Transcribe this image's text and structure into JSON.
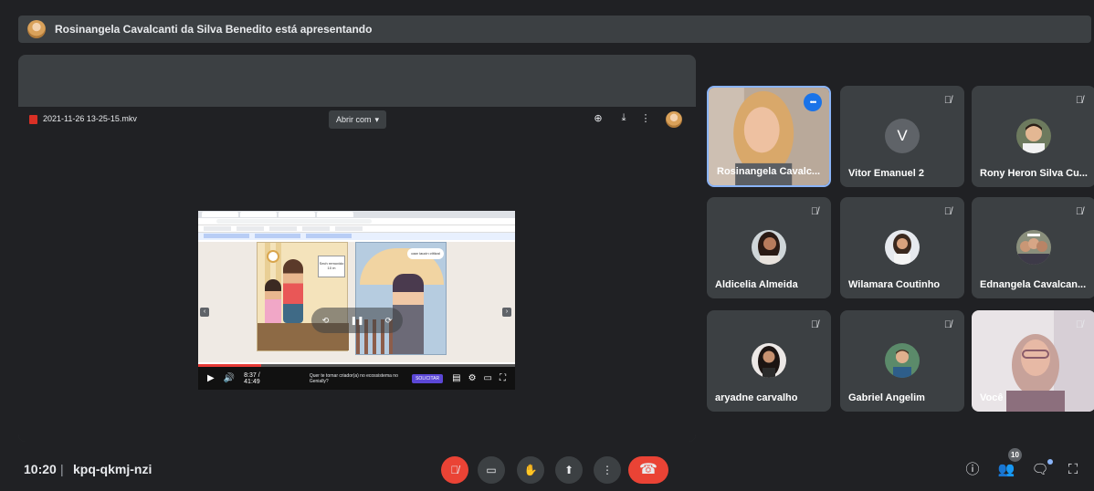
{
  "presentation_bar": {
    "text": "Rosinangela Cavalcanti da Silva Benedito está apresentando"
  },
  "viewer": {
    "file_name": "2021-11-26 13-25-15.mkv",
    "open_with": "Abrir com",
    "icons": [
      "drive-add-icon",
      "download-icon",
      "more-vert-icon"
    ]
  },
  "shared_video": {
    "bubble_left": "Sech removido 10 m",
    "bubble_right": "caar iaucin ctitizal",
    "logo": "genially",
    "time": "8:37 / 41:49",
    "cta": "Quer te tornar criador(a) no ecossistema no Genially?",
    "cta_button": "SOLICITAR",
    "progress_fraction": 0.2
  },
  "participants": [
    {
      "name": "Rosinangela Cavalc...",
      "kind": "video",
      "speaking": true
    },
    {
      "name": "Vitor Emanuel 2",
      "kind": "letter",
      "letter": "V",
      "muted": true
    },
    {
      "name": "Rony Heron Silva Cu...",
      "kind": "photo",
      "muted": true
    },
    {
      "name": "Aldicelia Almeida",
      "kind": "photo",
      "muted": true
    },
    {
      "name": "Wilamara Coutinho",
      "kind": "photo",
      "muted": true
    },
    {
      "name": "Ednangela Cavalcan...",
      "kind": "photo",
      "muted": true
    },
    {
      "name": "aryadne carvalho",
      "kind": "photo",
      "muted": true
    },
    {
      "name": "Gabriel Angelim",
      "kind": "photo",
      "muted": true
    },
    {
      "name": "Você",
      "kind": "video",
      "muted": true
    }
  ],
  "bottom_bar": {
    "time": "10:20",
    "separator": "|",
    "meeting_code": "kpq-qkmj-nzi",
    "people_count": "10"
  },
  "colors": {
    "accent": "#8ab4f8",
    "danger": "#ea4335",
    "surface": "#3c4043",
    "background": "#202124"
  }
}
